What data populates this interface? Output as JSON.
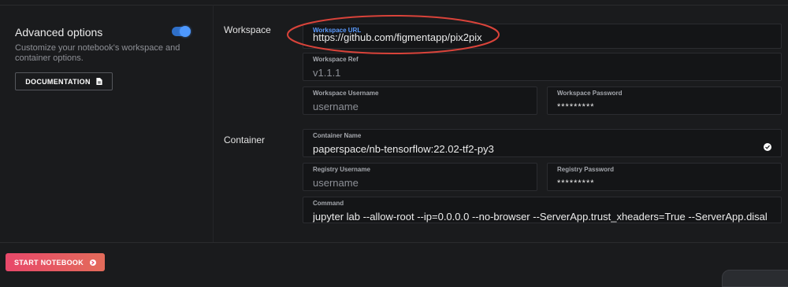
{
  "sidebar": {
    "advanced_title": "Advanced options",
    "advanced_desc": "Customize your notebook's workspace and container options.",
    "advanced_toggle_on": true,
    "documentation_label": "DOCUMENTATION"
  },
  "workspace": {
    "section_label": "Workspace",
    "url": {
      "label": "Workspace URL",
      "value": "https://github.com/figmentapp/pix2pix"
    },
    "ref": {
      "label": "Workspace Ref",
      "value": "v1.1.1"
    },
    "username": {
      "label": "Workspace Username",
      "placeholder": "username"
    },
    "password": {
      "label": "Workspace Password",
      "value": "*********"
    }
  },
  "container": {
    "section_label": "Container",
    "name": {
      "label": "Container Name",
      "value": "paperspace/nb-tensorflow:22.02-tf2-py3"
    },
    "registry_username": {
      "label": "Registry Username",
      "placeholder": "username"
    },
    "registry_password": {
      "label": "Registry Password",
      "value": "*********"
    },
    "command": {
      "label": "Command",
      "value": "jupyter lab --allow-root --ip=0.0.0.0 --no-browser --ServerApp.trust_xheaders=True --ServerApp.disal"
    }
  },
  "footer": {
    "start_label": "START NOTEBOOK"
  },
  "colors": {
    "accent": "#4d98ff",
    "start_button": "#e8486a",
    "annotation": "#d9433a"
  }
}
